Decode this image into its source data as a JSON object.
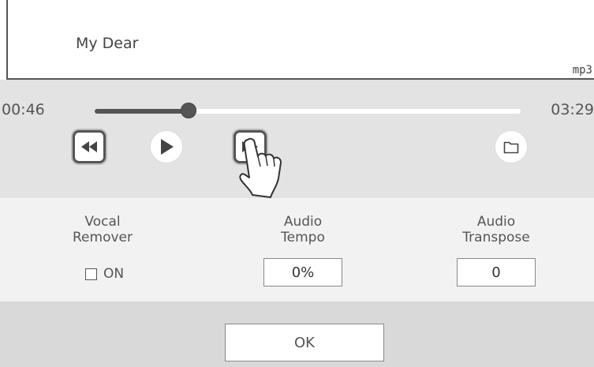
{
  "song": {
    "title": "My Dear",
    "file_type": "mp3"
  },
  "player": {
    "time_current": "00:46",
    "time_total": "03:29",
    "progress_fraction": 0.22
  },
  "settings": {
    "vocal_remover": {
      "label_line1": "Vocal",
      "label_line2": "Remover",
      "toggle_label": "ON",
      "checked": false
    },
    "tempo": {
      "label_line1": "Audio",
      "label_line2": "Tempo",
      "value": "0%"
    },
    "transpose": {
      "label_line1": "Audio",
      "label_line2": "Transpose",
      "value": "0"
    }
  },
  "footer": {
    "ok_label": "OK"
  },
  "icons": {
    "rewind": "rewind-icon",
    "play": "play-icon",
    "forward": "fast-forward-icon",
    "folder": "folder-icon",
    "hand": "pointing-hand-icon"
  }
}
